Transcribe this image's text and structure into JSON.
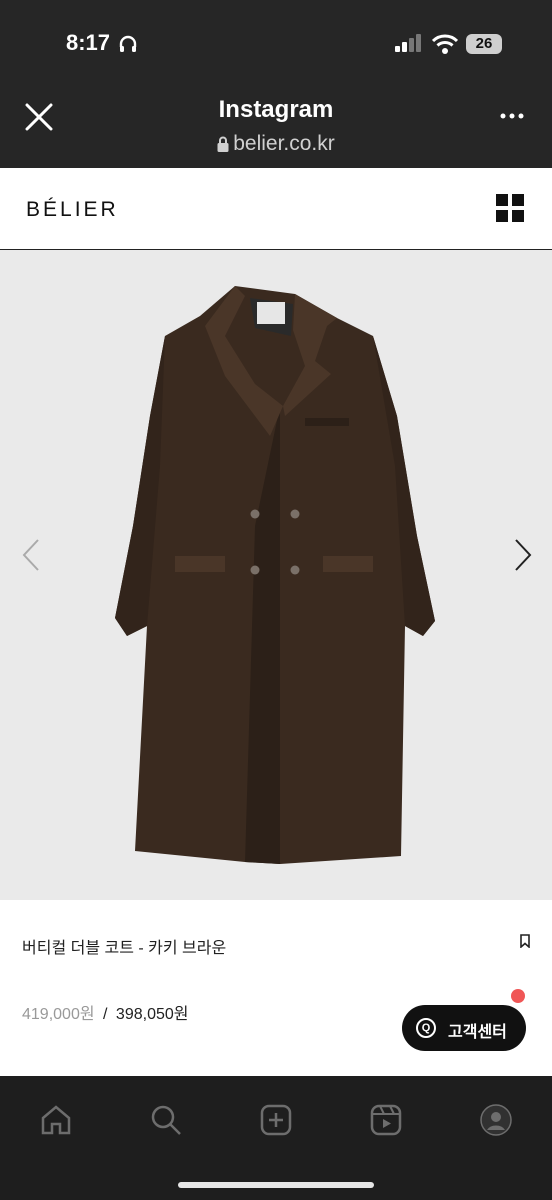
{
  "status_bar": {
    "time": "8:17",
    "battery": "26"
  },
  "browser": {
    "title": "Instagram",
    "url": "belier.co.kr"
  },
  "site": {
    "logo": "BÉLIER"
  },
  "product": {
    "name": "버티컬 더블 코트 - 카키 브라운",
    "price_original": "419,000원",
    "price_separator": "/",
    "price_sale": "398,050원",
    "color": "#3a2a1f"
  },
  "support": {
    "label": "고객센터",
    "icon": "Q"
  },
  "bottom_nav": [
    "home-icon",
    "search-icon",
    "create-icon",
    "reels-icon",
    "profile-icon"
  ]
}
